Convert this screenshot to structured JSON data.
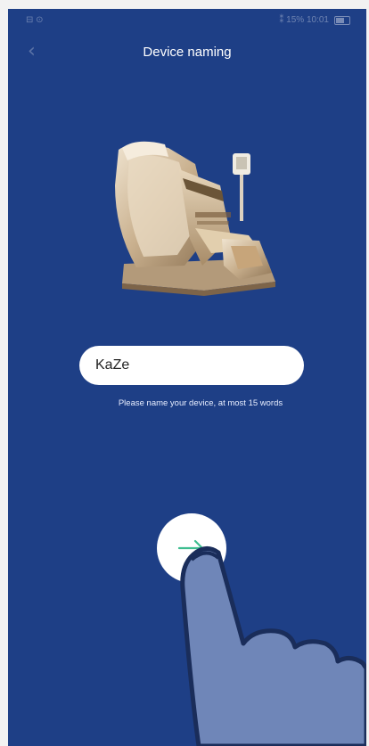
{
  "status_bar": {
    "left": "⊟ ⊙",
    "right": "⁑ 15% 10:01"
  },
  "header": {
    "title": "Device naming",
    "back_icon": "chevron-left-icon"
  },
  "device": {
    "image": "massage-chair-illustration"
  },
  "name_field": {
    "value": "KaZe"
  },
  "hint": {
    "text": "Please name your device, at most 15 words"
  },
  "next_button": {
    "icon": "arrow-right-icon",
    "icon_color": "#3dbd8f"
  },
  "colors": {
    "background": "#1e3f86",
    "card": "#ffffff",
    "accent": "#3dbd8f"
  }
}
